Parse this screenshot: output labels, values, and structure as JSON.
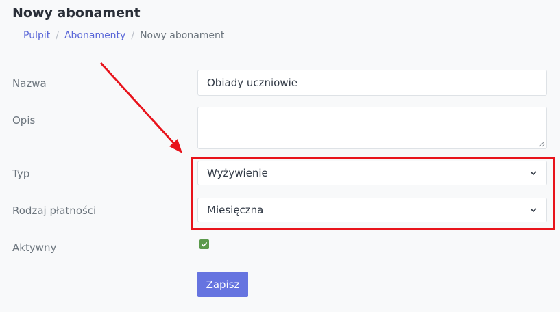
{
  "page": {
    "title": "Nowy abonament"
  },
  "breadcrumb": {
    "items": [
      "Pulpit",
      "Abonamenty"
    ],
    "current": "Nowy abonament",
    "separator": "/"
  },
  "form": {
    "name": {
      "label": "Nazwa",
      "value": "Obiady uczniowie"
    },
    "description": {
      "label": "Opis",
      "value": ""
    },
    "type": {
      "label": "Typ",
      "selected": "Wyżywienie"
    },
    "payment_type": {
      "label": "Rodzaj płatności",
      "selected": "Miesięczna"
    },
    "active": {
      "label": "Aktywny",
      "checked": true
    },
    "submit_label": "Zapisz"
  },
  "colors": {
    "accent": "#6674e0",
    "link": "#5a67d8",
    "annotation": "#e8131b",
    "checkbox": "#5b9a4b"
  },
  "icons": {
    "select_chevron": "chevron-down-icon",
    "checkbox_mark": "checkmark-icon",
    "textarea_resize": "resize-handle-icon"
  }
}
